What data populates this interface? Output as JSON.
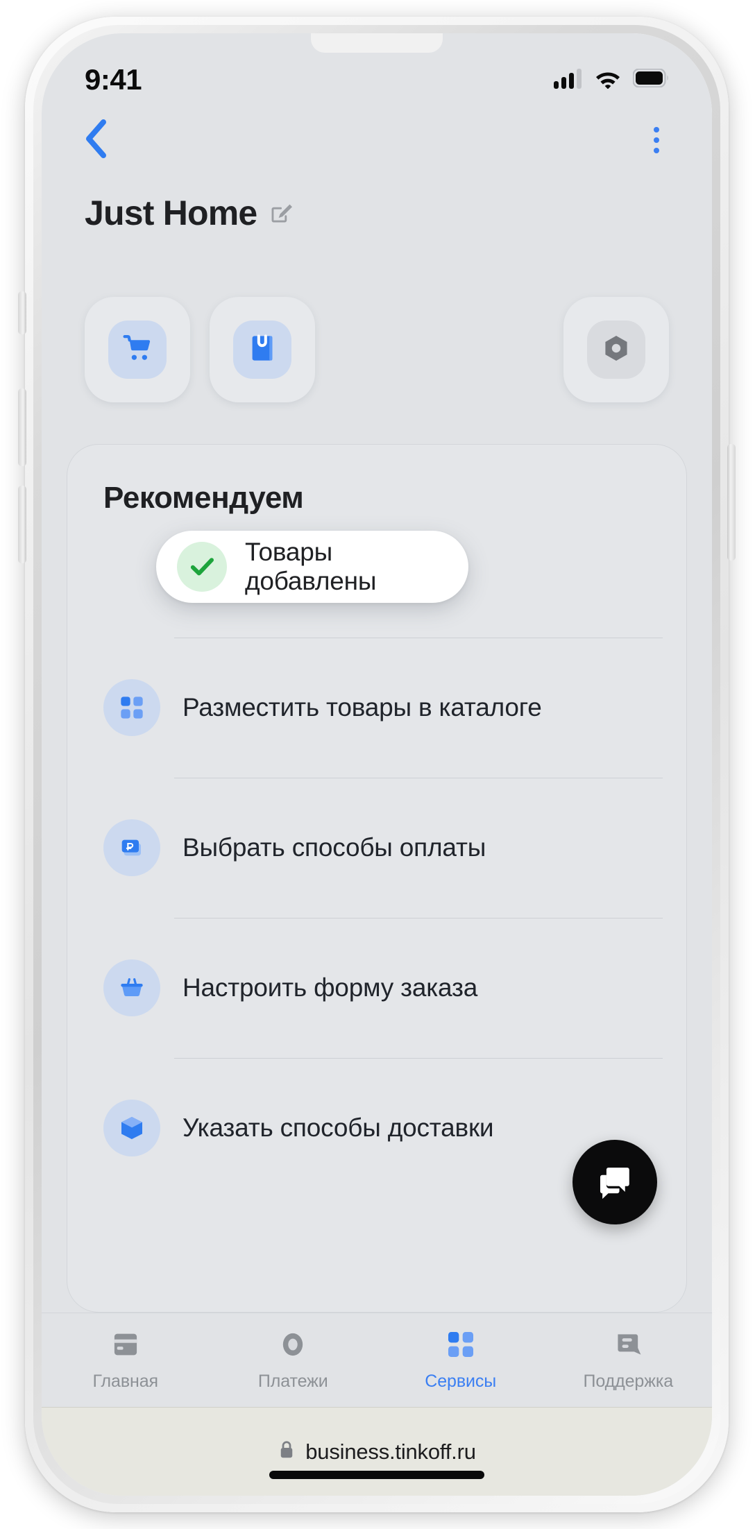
{
  "status_bar": {
    "time": "9:41",
    "cellular_icon": "cellular-signal-icon",
    "cellular_bars_filled": 3,
    "cellular_bars_total": 4,
    "wifi_icon": "wifi-icon",
    "battery_icon": "battery-full-icon",
    "battery_level": 100
  },
  "nav": {
    "back_icon": "chevron-left-icon",
    "menu_icon": "kebab-menu-icon"
  },
  "header": {
    "title": "Just Home",
    "edit_icon": "edit-pencil-icon"
  },
  "shortcuts": [
    {
      "id": "storefront",
      "icon": "shopping-cart-icon",
      "style": "blue"
    },
    {
      "id": "catalog",
      "icon": "catalog-book-icon",
      "style": "blue"
    },
    {
      "id": "settings",
      "icon": "hex-nut-settings-icon",
      "style": "gray"
    }
  ],
  "recommend": {
    "title": "Рекомендуем",
    "items": [
      {
        "label": "",
        "icon": "hidden-under-toast"
      },
      {
        "label": "Разместить товары в каталоге",
        "icon": "grid-squares-icon"
      },
      {
        "label": "Выбрать способы оплаты",
        "icon": "ruble-card-icon"
      },
      {
        "label": "Настроить форму заказа",
        "icon": "shopping-basket-icon"
      },
      {
        "label": "Указать способы доставки",
        "icon": "delivery-box-icon"
      }
    ]
  },
  "toast": {
    "text": "Товары добавлены",
    "icon": "check-mark-icon",
    "icon_color": "#1da43c",
    "bg_color": "#ffffff"
  },
  "fab": {
    "icon": "chat-bubble-icon",
    "bg_color": "#0b0b0c"
  },
  "tabbar": {
    "active_color": "#3b7ff2",
    "inactive_color": "#8d9196",
    "tabs": [
      {
        "label": "Главная",
        "icon": "card-icon",
        "active": false
      },
      {
        "label": "Платежи",
        "icon": "ring-circle-icon",
        "active": false
      },
      {
        "label": "Сервисы",
        "icon": "grid-squares-icon",
        "active": true
      },
      {
        "label": "Поддержка",
        "icon": "chat-bubble-icon",
        "active": false
      }
    ]
  },
  "browser": {
    "lock_icon": "lock-icon",
    "url": "business.tinkoff.ru"
  },
  "theme": {
    "screen_bg": "#e1e3e6",
    "accent_blue": "#3b7ff2",
    "icon_tint_blue": "#3b7ff2",
    "icon_bubble_blue": "#ccd9ef",
    "text_primary": "#1f2023",
    "text_muted": "#8d9196"
  }
}
